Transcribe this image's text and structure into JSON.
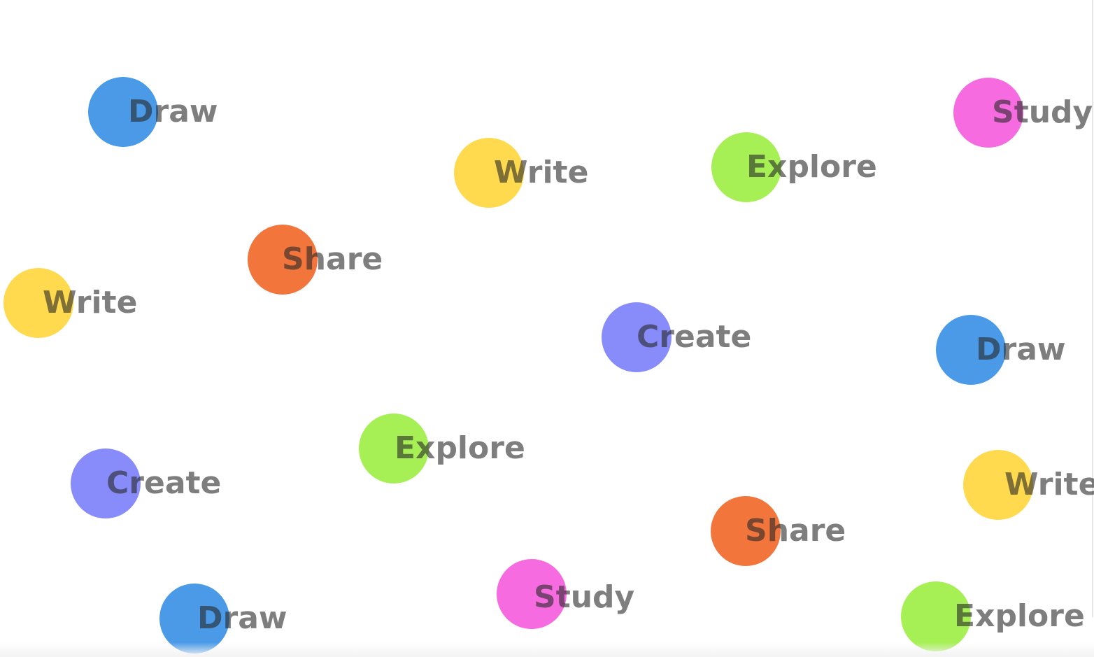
{
  "colors": {
    "draw": "#4A9AE8",
    "write": "#FFD94E",
    "explore": "#A6EF55",
    "share": "#F2753C",
    "create": "#888CFA",
    "study": "#F66BE0",
    "label_text": "#7a7a7a"
  },
  "items": [
    {
      "label": "Draw",
      "kind": "draw"
    },
    {
      "label": "Study",
      "kind": "study"
    },
    {
      "label": "Write",
      "kind": "write"
    },
    {
      "label": "Explore",
      "kind": "explore"
    },
    {
      "label": "Share",
      "kind": "share"
    },
    {
      "label": "Write",
      "kind": "write"
    },
    {
      "label": "Create",
      "kind": "create"
    },
    {
      "label": "Draw",
      "kind": "draw"
    },
    {
      "label": "Explore",
      "kind": "explore"
    },
    {
      "label": "Create",
      "kind": "create"
    },
    {
      "label": "Write",
      "kind": "write"
    },
    {
      "label": "Share",
      "kind": "share"
    },
    {
      "label": "Study",
      "kind": "study"
    },
    {
      "label": "Draw",
      "kind": "draw"
    },
    {
      "label": "Explore",
      "kind": "explore"
    }
  ]
}
